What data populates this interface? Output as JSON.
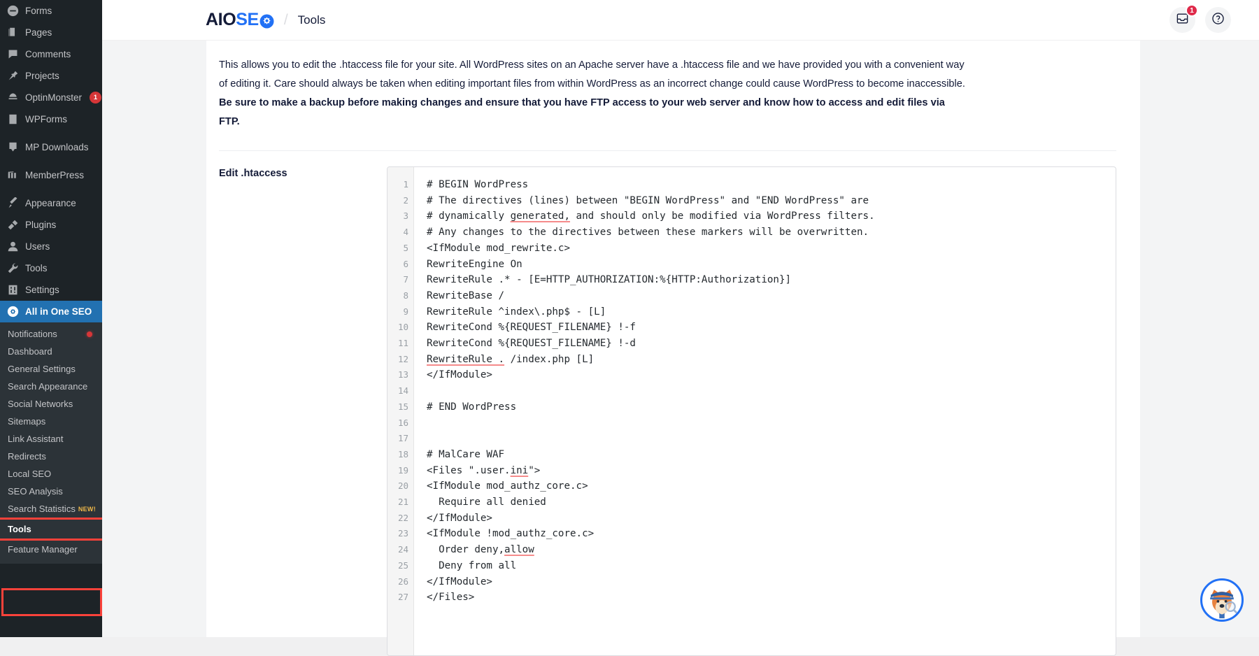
{
  "wp_sidebar": {
    "items": [
      {
        "label": "Forms",
        "icon": "forms-icon",
        "badge": null
      },
      {
        "label": "Pages",
        "icon": "pages-icon",
        "badge": null
      },
      {
        "label": "Comments",
        "icon": "comments-icon",
        "badge": null
      },
      {
        "label": "Projects",
        "icon": "pin-icon",
        "badge": null
      },
      {
        "label": "OptinMonster",
        "icon": "optinmonster-icon",
        "badge": "1"
      },
      {
        "label": "WPForms",
        "icon": "wpforms-icon",
        "badge": null
      },
      {
        "label": "MP Downloads",
        "icon": "download-icon",
        "badge": null
      },
      {
        "label": "MemberPress",
        "icon": "memberpress-icon",
        "badge": null
      },
      {
        "label": "Appearance",
        "icon": "brush-icon",
        "badge": null
      },
      {
        "label": "Plugins",
        "icon": "plug-icon",
        "badge": null
      },
      {
        "label": "Users",
        "icon": "user-icon",
        "badge": null
      },
      {
        "label": "Tools",
        "icon": "wrench-icon",
        "badge": null
      },
      {
        "label": "Settings",
        "icon": "sliders-icon",
        "badge": null
      }
    ],
    "active_item": {
      "label": "All in One SEO",
      "icon": "aioseo-icon"
    },
    "submenu": [
      {
        "label": "Notifications",
        "dot": true,
        "new": false,
        "highlighted": false
      },
      {
        "label": "Dashboard",
        "dot": false,
        "new": false,
        "highlighted": false
      },
      {
        "label": "General Settings",
        "dot": false,
        "new": false,
        "highlighted": false
      },
      {
        "label": "Search Appearance",
        "dot": false,
        "new": false,
        "highlighted": false
      },
      {
        "label": "Social Networks",
        "dot": false,
        "new": false,
        "highlighted": false
      },
      {
        "label": "Sitemaps",
        "dot": false,
        "new": false,
        "highlighted": false
      },
      {
        "label": "Link Assistant",
        "dot": false,
        "new": false,
        "highlighted": false
      },
      {
        "label": "Redirects",
        "dot": false,
        "new": false,
        "highlighted": false
      },
      {
        "label": "Local SEO",
        "dot": false,
        "new": false,
        "highlighted": false
      },
      {
        "label": "SEO Analysis",
        "dot": false,
        "new": false,
        "highlighted": false
      },
      {
        "label": "Search Statistics",
        "dot": false,
        "new": true,
        "new_label": "NEW!",
        "highlighted": false
      },
      {
        "label": "Tools",
        "dot": false,
        "new": false,
        "highlighted": true
      },
      {
        "label": "Feature Manager",
        "dot": false,
        "new": false,
        "highlighted": false
      }
    ]
  },
  "header": {
    "logo_part1": "AIO",
    "logo_part2": "SE",
    "logo_icon": "gear-icon",
    "separator": "/",
    "breadcrumb_title": "Tools",
    "inbox_badge": "1",
    "inbox_icon": "inbox-icon",
    "help_icon": "help-circle-icon"
  },
  "main": {
    "intro_part1": "This allows you to edit the .htaccess file for your site. All WordPress sites on an Apache server have a .htaccess file and we have provided you with a convenient way of editing it. Care should always be taken when editing important files from within WordPress as an incorrect change could cause WordPress to become inaccessible. ",
    "intro_bold": "Be sure to make a backup before making changes and ensure that you have FTP access to your web server and know how to access and edit files via FTP.",
    "field_label": "Edit .htaccess",
    "code_lines": [
      {
        "n": "1",
        "text": "# BEGIN WordPress"
      },
      {
        "n": "2",
        "text": "# The directives (lines) between \"BEGIN WordPress\" and \"END WordPress\" are"
      },
      {
        "n": "3",
        "text": "# dynamically generated, and should only be modified via WordPress filters.",
        "squiggle": "generated,"
      },
      {
        "n": "4",
        "text": "# Any changes to the directives between these markers will be overwritten."
      },
      {
        "n": "5",
        "text": "<IfModule mod_rewrite.c>"
      },
      {
        "n": "6",
        "text": "RewriteEngine On"
      },
      {
        "n": "7",
        "text": "RewriteRule .* - [E=HTTP_AUTHORIZATION:%{HTTP:Authorization}]"
      },
      {
        "n": "8",
        "text": "RewriteBase /"
      },
      {
        "n": "9",
        "text": "RewriteRule ^index\\.php$ - [L]"
      },
      {
        "n": "10",
        "text": "RewriteCond %{REQUEST_FILENAME} !-f"
      },
      {
        "n": "11",
        "text": "RewriteCond %{REQUEST_FILENAME} !-d"
      },
      {
        "n": "12",
        "text": "RewriteRule . /index.php [L]",
        "squiggle": "RewriteRule ."
      },
      {
        "n": "13",
        "text": "</IfModule>"
      },
      {
        "n": "14",
        "text": ""
      },
      {
        "n": "15",
        "text": "# END WordPress"
      },
      {
        "n": "16",
        "text": ""
      },
      {
        "n": "17",
        "text": ""
      },
      {
        "n": "18",
        "text": "# MalCare WAF"
      },
      {
        "n": "19",
        "text": "<Files \".user.ini\">",
        "squiggle": "ini"
      },
      {
        "n": "20",
        "text": "<IfModule mod_authz_core.c>"
      },
      {
        "n": "21",
        "text": "  Require all denied"
      },
      {
        "n": "22",
        "text": "</IfModule>"
      },
      {
        "n": "23",
        "text": "<IfModule !mod_authz_core.c>"
      },
      {
        "n": "24",
        "text": "  Order deny,allow",
        "squiggle": "allow"
      },
      {
        "n": "25",
        "text": "  Deny from all"
      },
      {
        "n": "26",
        "text": "</IfModule>"
      },
      {
        "n": "27",
        "text": "</Files>"
      }
    ]
  },
  "mascot": {
    "name": "aioseo-mascot"
  },
  "colors": {
    "wp_sidebar_bg": "#1d2327",
    "wp_submenu_bg": "#2c3338",
    "wp_active_blue": "#2271b1",
    "aioseo_blue": "#2271f5",
    "highlight_red": "#f9423a",
    "badge_red": "#d63638",
    "new_yellow": "#f0b849"
  }
}
